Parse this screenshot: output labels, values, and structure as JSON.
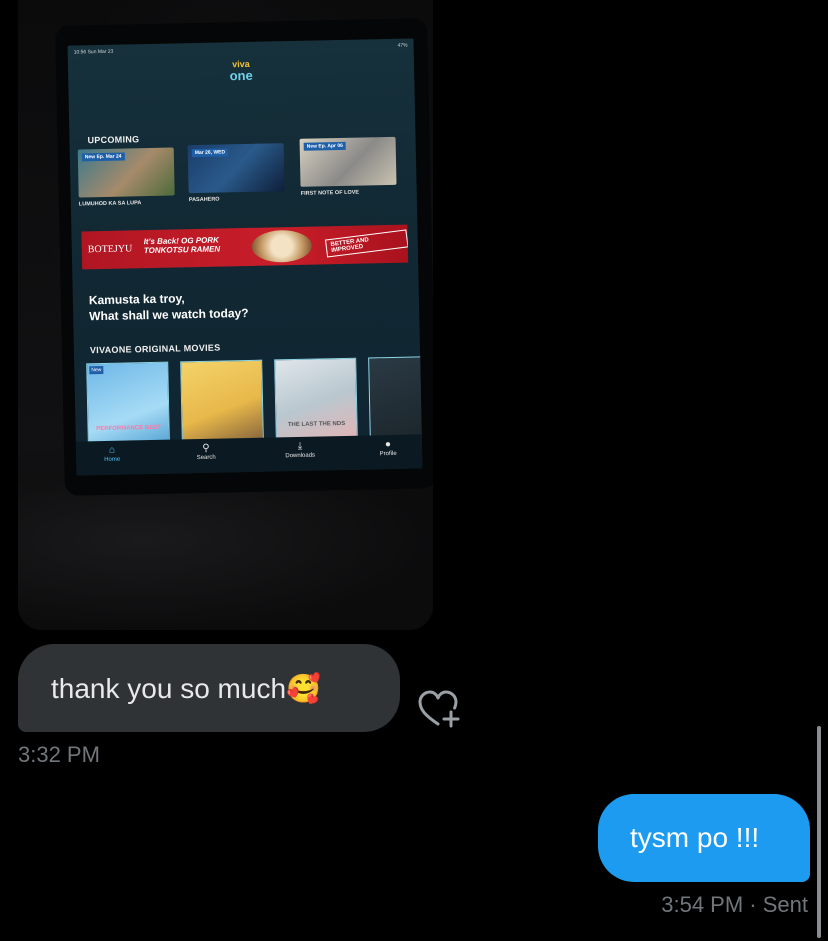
{
  "photo": {
    "statusbar": {
      "time": "10:56 Sun Mar 23",
      "battery": "47%"
    },
    "app": {
      "logo_top": "viva",
      "logo_bottom": "one",
      "upcoming_title": "UPCOMING",
      "upcoming": [
        {
          "tag": "New Ep. Mar 24",
          "caption": "LUMUHOD KA SA LUPA"
        },
        {
          "tag": "Mar 26, WED",
          "caption": "PASAHERO"
        },
        {
          "tag": "New Ep. Apr 06",
          "caption": "FIRST NOTE OF LOVE"
        }
      ],
      "banner": {
        "brand": "BOTEJYU",
        "promo_line1": "It's Back! OG PORK",
        "promo_line2": "TONKOTSU RAMEN",
        "stamp": "BETTER AND IMPROVED"
      },
      "greeting_line1": "Kamusta ka troy,",
      "greeting_line2": "What shall we watch today?",
      "movies_title": "VIVAONE ORIGINAL MOVIES",
      "movies": [
        {
          "badge": "New",
          "title": "PERFORMANCE BEST"
        },
        {
          "badge": "",
          "title": ""
        },
        {
          "badge": "",
          "title": "THE LAST THE NDS"
        },
        {
          "badge": "",
          "title": ""
        }
      ],
      "nav": [
        {
          "label": "Home",
          "icon": "home-icon"
        },
        {
          "label": "Search",
          "icon": "search-icon"
        },
        {
          "label": "Downloads",
          "icon": "download-icon"
        },
        {
          "label": "Profile",
          "icon": "profile-icon"
        }
      ]
    }
  },
  "messages": {
    "received": {
      "text": "thank you so much🥰",
      "time": "3:32 PM"
    },
    "sent": {
      "text": "tysm po !!!",
      "time": "3:54 PM",
      "status": "· Sent"
    }
  },
  "colors": {
    "sent_bubble": "#1d9bf0",
    "received_bubble": "#2f3336",
    "timestamp": "#71767b"
  }
}
